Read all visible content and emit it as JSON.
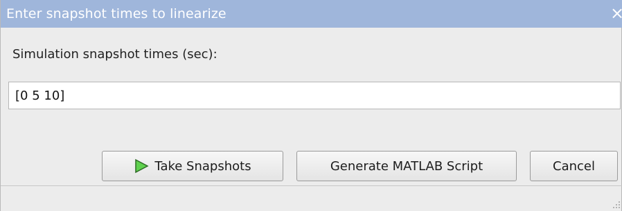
{
  "window": {
    "title": "Enter snapshot times to linearize",
    "close_glyph": "×"
  },
  "form": {
    "label": "Simulation snapshot times (sec):",
    "input_value": "[0 5 10]"
  },
  "buttons": {
    "take_snapshots": "Take Snapshots",
    "generate_script": "Generate MATLAB Script",
    "cancel": "Cancel"
  },
  "icons": {
    "play": "play-icon",
    "close": "close-icon",
    "resize": "resize-grip-icon"
  },
  "colors": {
    "titlebar": "#9fb6db",
    "background": "#ececec",
    "play_icon_fill": "#5fd14e"
  }
}
